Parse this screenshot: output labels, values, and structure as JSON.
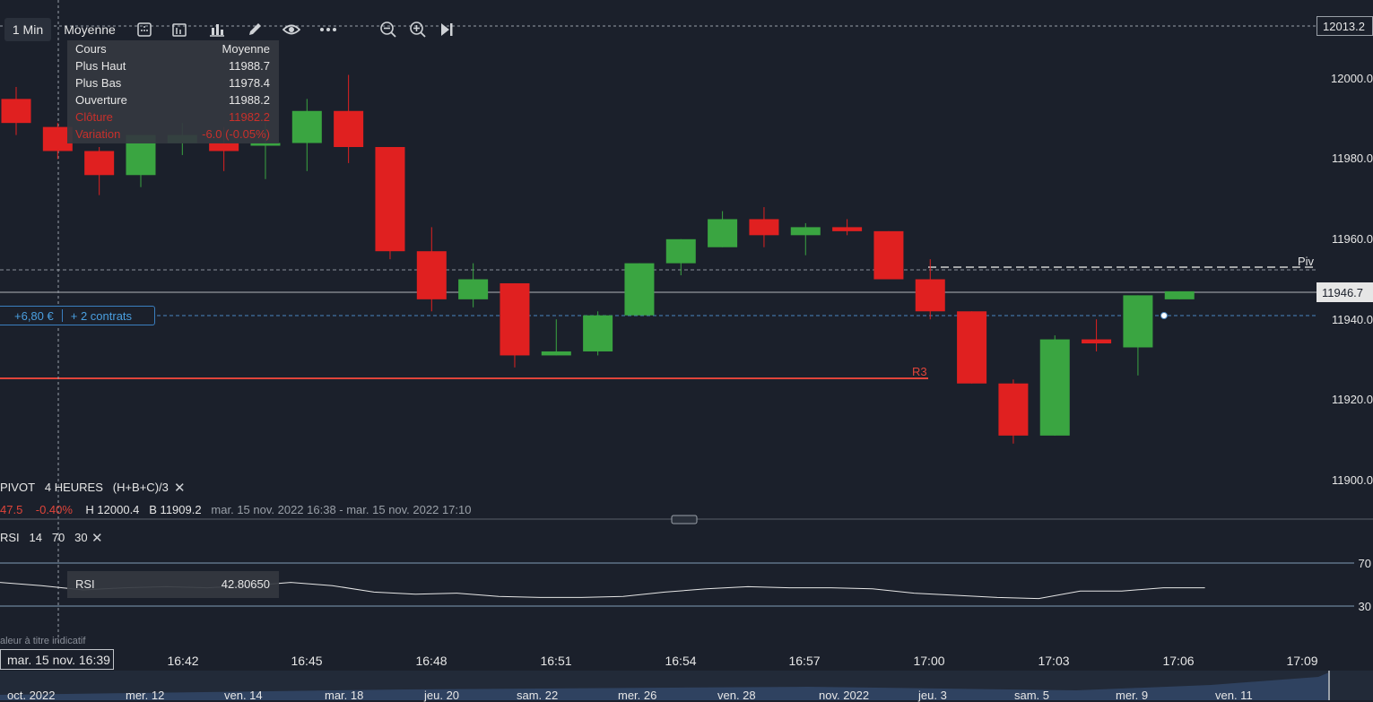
{
  "toolbar": {
    "interval": "1 Min",
    "price_type": "Moyenne",
    "icons": [
      "indicators-icon",
      "layout-icon",
      "chart-type-icon",
      "draw-icon",
      "eye-icon",
      "more-icon",
      "zoom-out-icon",
      "zoom-in-icon",
      "skip-to-end-icon"
    ]
  },
  "info_box": {
    "header_label": "Cours",
    "header_value": "Moyenne",
    "rows": [
      {
        "label": "Plus Haut",
        "value": "11988.7"
      },
      {
        "label": "Plus Bas",
        "value": "11978.4"
      },
      {
        "label": "Ouverture",
        "value": "11988.2"
      },
      {
        "label": "Clôture",
        "value": "11982.2"
      },
      {
        "label": "Variation",
        "value": "-6.0 (-0.05%)"
      }
    ]
  },
  "price_axis": {
    "top_label": "12013.2",
    "current_label": "11946.7",
    "ticks": [
      "12000.0",
      "11980.0",
      "11960.0",
      "11940.0",
      "11920.0",
      "11900.0"
    ]
  },
  "position": {
    "pnl": "+6,80 €",
    "contracts": "+ 2 contrats"
  },
  "levels": {
    "pivot": "Piv",
    "r3": "R3"
  },
  "pivot_indicator": {
    "name": "PIVOT",
    "period": "4 HEURES",
    "formula": "(H+B+C)/3"
  },
  "stats": {
    "value": "47.5",
    "change": "-0.40%",
    "high": "H 12000.4",
    "low": "B 11909.2",
    "range": "mar. 15 nov. 2022 16:38 - mar. 15 nov. 2022 17:10"
  },
  "rsi_indicator": {
    "name": "RSI",
    "p1": "14",
    "p2": "70",
    "p3": "30",
    "box_label": "RSI",
    "box_value": "42.80650",
    "upper": "70",
    "lower": "30"
  },
  "footer": {
    "disclaimer": "aleur à titre indicatif",
    "cursor_time": "mar. 15 nov. 16:39"
  },
  "time_axis": [
    "16:42",
    "16:45",
    "16:48",
    "16:51",
    "16:54",
    "16:57",
    "17:00",
    "17:03",
    "17:06",
    "17:09"
  ],
  "navigator": [
    "oct. 2022",
    "mer. 12",
    "ven. 14",
    "mar. 18",
    "jeu. 20",
    "sam. 22",
    "mer. 26",
    "ven. 28",
    "nov. 2022",
    "jeu. 3",
    "sam. 5",
    "mer. 9",
    "ven. 11"
  ],
  "colors": {
    "up": "#3aa541",
    "down": "#e02020",
    "background": "#1b202b",
    "accent": "#4a9fe0",
    "r3": "#e0443a"
  },
  "chart_data": {
    "type": "candlestick",
    "ylim": [
      11895,
      12015
    ],
    "x": [
      "16:38",
      "16:39",
      "16:40",
      "16:41",
      "16:42",
      "16:43",
      "16:44",
      "16:45",
      "16:46",
      "16:47",
      "16:48",
      "16:49",
      "16:50",
      "16:51",
      "16:52",
      "16:53",
      "16:54",
      "16:55",
      "16:56",
      "16:57",
      "16:58",
      "16:59",
      "17:00",
      "17:01",
      "17:02",
      "17:03",
      "17:04",
      "17:05",
      "17:06"
    ],
    "candles": [
      {
        "o": 11995,
        "h": 11998,
        "l": 11986,
        "c": 11989
      },
      {
        "o": 11988,
        "h": 11989,
        "l": 11980,
        "c": 11982
      },
      {
        "o": 11982,
        "h": 11983,
        "l": 11971,
        "c": 11976
      },
      {
        "o": 11976,
        "h": 11986,
        "l": 11973,
        "c": 11986
      },
      {
        "o": 11984,
        "h": 11989,
        "l": 11981,
        "c": 11986
      },
      {
        "o": 11984,
        "h": 11988,
        "l": 11977,
        "c": 11982
      },
      {
        "o": 11984,
        "h": 11989,
        "l": 11975,
        "c": 11984
      },
      {
        "o": 11984,
        "h": 11995,
        "l": 11977,
        "c": 11992
      },
      {
        "o": 11992,
        "h": 12001,
        "l": 11979,
        "c": 11983
      },
      {
        "o": 11983,
        "h": 11983,
        "l": 11955,
        "c": 11957
      },
      {
        "o": 11957,
        "h": 11963,
        "l": 11942,
        "c": 11945
      },
      {
        "o": 11945,
        "h": 11954,
        "l": 11943,
        "c": 11950
      },
      {
        "o": 11949,
        "h": 11949,
        "l": 11928,
        "c": 11931
      },
      {
        "o": 11931,
        "h": 11940,
        "l": 11931,
        "c": 11932
      },
      {
        "o": 11932,
        "h": 11942,
        "l": 11931,
        "c": 11941
      },
      {
        "o": 11941,
        "h": 11954,
        "l": 11941,
        "c": 11954
      },
      {
        "o": 11954,
        "h": 11960,
        "l": 11951,
        "c": 11960
      },
      {
        "o": 11958,
        "h": 11967,
        "l": 11958,
        "c": 11965
      },
      {
        "o": 11965,
        "h": 11968,
        "l": 11958,
        "c": 11961
      },
      {
        "o": 11961,
        "h": 11964,
        "l": 11956,
        "c": 11963
      },
      {
        "o": 11963,
        "h": 11965,
        "l": 11961,
        "c": 11962
      },
      {
        "o": 11962,
        "h": 11962,
        "l": 11950,
        "c": 11950
      },
      {
        "o": 11950,
        "h": 11955,
        "l": 11940,
        "c": 11942
      },
      {
        "o": 11942,
        "h": 11942,
        "l": 11924,
        "c": 11924
      },
      {
        "o": 11924,
        "h": 11925,
        "l": 11909,
        "c": 11911
      },
      {
        "o": 11911,
        "h": 11936,
        "l": 11911,
        "c": 11935
      },
      {
        "o": 11935,
        "h": 11940,
        "l": 11932,
        "c": 11934
      },
      {
        "o": 11933,
        "h": 11946,
        "l": 11926,
        "c": 11946
      },
      {
        "o": 11945,
        "h": 11947,
        "l": 11945,
        "c": 11947
      }
    ],
    "levels": [
      {
        "name": "Piv",
        "value": 11952
      },
      {
        "name": "R3",
        "value": 11925
      },
      {
        "name": "position",
        "value": 11941
      },
      {
        "name": "current",
        "value": 11946.7
      },
      {
        "name": "top",
        "value": 12013.2
      }
    ],
    "rsi": {
      "ylim": [
        20,
        80
      ],
      "values": [
        52,
        49,
        45,
        47,
        48,
        47,
        49,
        52,
        49,
        43,
        41,
        42,
        39,
        38,
        38,
        39,
        43,
        46,
        48,
        47,
        47,
        46,
        42,
        40,
        38,
        37,
        44,
        44,
        47,
        47
      ]
    }
  }
}
